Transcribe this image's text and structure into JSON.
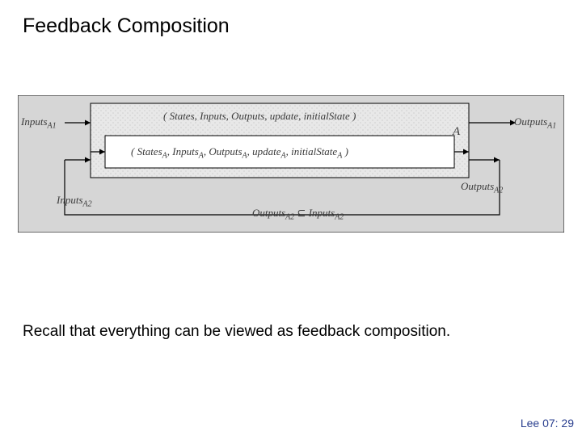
{
  "title": "Feedback Composition",
  "note": "Recall that everything can be viewed as feedback composition.",
  "footer": "Lee 07: 29",
  "diagram": {
    "inputsA1": "Inputs",
    "inputsA1_sub": "A1",
    "outputsA1": "Outputs",
    "outputsA1_sub": "A1",
    "inputsA2": "Inputs",
    "inputsA2_sub": "A2",
    "outputsA2": "Outputs",
    "outputsA2_sub": "A2",
    "subset_rel_left": "Outputs",
    "subset_rel_left_sub": "A2",
    "subset_rel_mid": " ⊆ ",
    "subset_rel_right": "Inputs",
    "subset_rel_right_sub": "A2",
    "blockA_tuple": "( States, Inputs, Outputs, update, initialState )",
    "blockA_label": "A",
    "blockB_pre": "( States",
    "blockB_s1": "A",
    "blockB_c1": ", Inputs",
    "blockB_s2": "A",
    "blockB_c2": ", Outputs",
    "blockB_s3": "A",
    "blockB_c3": ", update",
    "blockB_s4": "A",
    "blockB_c4": ", initialState",
    "blockB_s5": "A",
    "blockB_post": " )"
  }
}
